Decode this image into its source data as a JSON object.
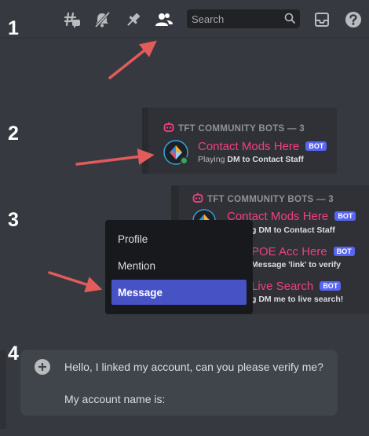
{
  "steps": [
    "1",
    "2",
    "3",
    "4"
  ],
  "toolbar": {
    "icons": [
      "threads-icon",
      "mute-bell-icon",
      "pin-icon",
      "member-list-icon",
      "inbox-icon",
      "help-icon"
    ],
    "search_placeholder": "Search"
  },
  "members_panel": {
    "header": "TFT COMMUNITY BOTS — 3",
    "members": [
      {
        "name": "Contact Mods Here",
        "badge": "BOT",
        "status_prefix": "Playing ",
        "status_bold": "DM to Contact Staff"
      },
      {
        "name": "POE Acc Here",
        "badge": "BOT",
        "status_prefix": "",
        "status_bold": "Message 'link' to verify"
      },
      {
        "name": "Live Search",
        "badge": "BOT",
        "status_prefix": "",
        "status_bold": "DM me to live search!"
      }
    ],
    "partial_status": [
      {
        "prefix": "",
        "bold": "g DM to Contact Staff"
      },
      {
        "prefix": "",
        "bold": "Message 'link' to verify"
      },
      {
        "prefix": "",
        "bold": "g DM me to live search!"
      }
    ]
  },
  "context_menu": {
    "items": [
      "Profile",
      "Mention",
      "Message"
    ],
    "active": "Message"
  },
  "message_input": {
    "line1": "Hello, I linked my account, can you please verify me?",
    "line2": "My account name is:"
  },
  "colors": {
    "background": "#36393f",
    "panel": "#2f3136",
    "bot_name": "#f04085",
    "bot_badge": "#5865f2",
    "menu_highlight": "#4752c4",
    "arrow": "#e35b5b",
    "online": "#3ba55d"
  }
}
